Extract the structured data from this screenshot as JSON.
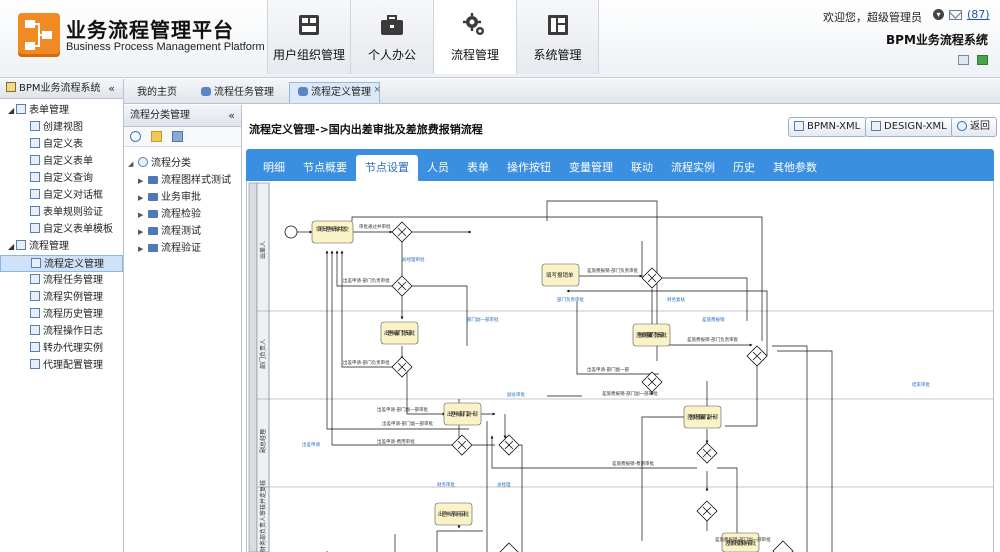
{
  "header": {
    "title": "业务流程管理平台",
    "subtitle": "Business Process Management Platform",
    "nav": [
      {
        "label": "用户组织管理",
        "icon": "org-icon"
      },
      {
        "label": "个人办公",
        "icon": "briefcase-icon"
      },
      {
        "label": "流程管理",
        "icon": "gears-icon"
      },
      {
        "label": "系统管理",
        "icon": "window-icon"
      }
    ],
    "active_nav": "流程管理",
    "welcome": "欢迎您，超级管理员",
    "mail_count": "(87)",
    "system_name": "BPM业务流程系统"
  },
  "sidebar": {
    "title": "BPM业务流程系统",
    "groups": [
      {
        "label": "表单管理",
        "items": [
          "创建视图",
          "自定义表",
          "自定义表单",
          "自定义查询",
          "自定义对话框",
          "表单规则验证",
          "自定义表单模板"
        ]
      },
      {
        "label": "流程管理",
        "items": [
          "流程定义管理",
          "流程任务管理",
          "流程实例管理",
          "流程历史管理",
          "流程操作日志",
          "转办代理实例",
          "代理配置管理"
        ]
      }
    ],
    "selected": "流程定义管理"
  },
  "tabs": [
    {
      "label": "我的主页"
    },
    {
      "label": "流程任务管理"
    },
    {
      "label": "流程定义管理"
    }
  ],
  "category_panel": {
    "title": "流程分类管理",
    "root": "流程分类",
    "children": [
      "流程图样式测试",
      "业务审批",
      "流程检验",
      "流程测试",
      "流程验证"
    ]
  },
  "main": {
    "breadcrumb": "流程定义管理->国内出差审批及差旅费报销流程",
    "buttons": {
      "bpmn": "BPMN-XML",
      "design": "DESIGN-XML",
      "back": "返回"
    },
    "ptabs": [
      "明细",
      "节点概要",
      "节点设置",
      "人员",
      "表单",
      "操作按钮",
      "变量管理",
      "联动",
      "流程实例",
      "历史",
      "其他参数"
    ],
    "active_ptab": "节点设置"
  },
  "diagram": {
    "lanes": [
      "出差人",
      "部门负责人",
      "副总经理",
      "财务部负责人审核并走复核"
    ],
    "tasks": [
      "填写出差申请单并提交",
      "填写报销单",
      "出差申请-部门负责审批",
      "出差申请-部门副一部",
      "差旅费报销-部门副一部",
      "差旅费报销-部门负责审批",
      "出差申请-费用审批",
      "差旅费报销-费用审批"
    ],
    "edge_labels": [
      "审批通过并审批",
      "出差申请-部门负责审批",
      "出差申请-部门负责审批",
      "出差申请-部门副一部审批",
      "差旅费报销-部门负责审批",
      "出差申请-部门副一部",
      "差旅费报销-部门副一部审批",
      "差旅费报销-部门负责审批",
      "出差申请-部门副一部审批",
      "出差申请-费用审批",
      "差旅费报销-费用审批",
      "差旅费报销-部门副一部审批"
    ],
    "blue_labels": [
      "总经理审批",
      "部门副一部审批",
      "部门负责审批",
      "差旅费报销",
      "副总审批",
      "财务审批",
      "总经理",
      "结束审批",
      "出差申请",
      "财务复核"
    ]
  }
}
